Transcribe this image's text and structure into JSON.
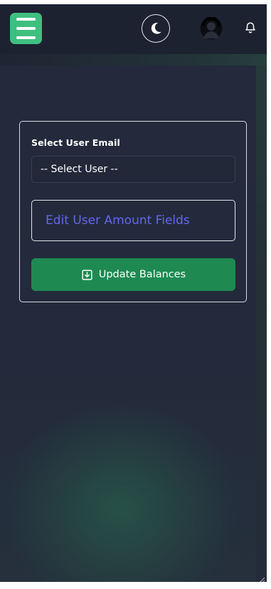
{
  "header": {
    "menu_icon": "hamburger-menu-icon",
    "theme_icon": "moon-icon",
    "avatar_icon": "user-avatar-icon",
    "notification_icon": "bell-icon"
  },
  "form": {
    "select_label": "Select User Email",
    "select_value": "-- Select User --",
    "section_title": "Edit User Amount Fields",
    "submit_label": "Update Balances",
    "submit_icon": "download-box-icon"
  },
  "colors": {
    "background": "#252b3d",
    "accent_green": "#1e8a52",
    "menu_green": "#3fbf7f",
    "title_purple": "#6566ef"
  }
}
